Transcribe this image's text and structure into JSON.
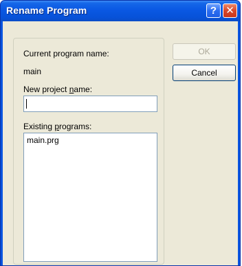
{
  "window": {
    "title": "Rename Program",
    "help_button": "?",
    "close_button": "✕"
  },
  "form": {
    "current_label": "Current program name:",
    "current_value": "main",
    "new_label_pre": "New project ",
    "new_label_u": "n",
    "new_label_post": "ame:",
    "new_value": "",
    "existing_label_pre": "Existing ",
    "existing_label_u": "p",
    "existing_label_post": "rograms:",
    "existing_items": [
      "main.prg"
    ]
  },
  "buttons": {
    "ok_label": "OK",
    "cancel_label": "Cancel"
  }
}
